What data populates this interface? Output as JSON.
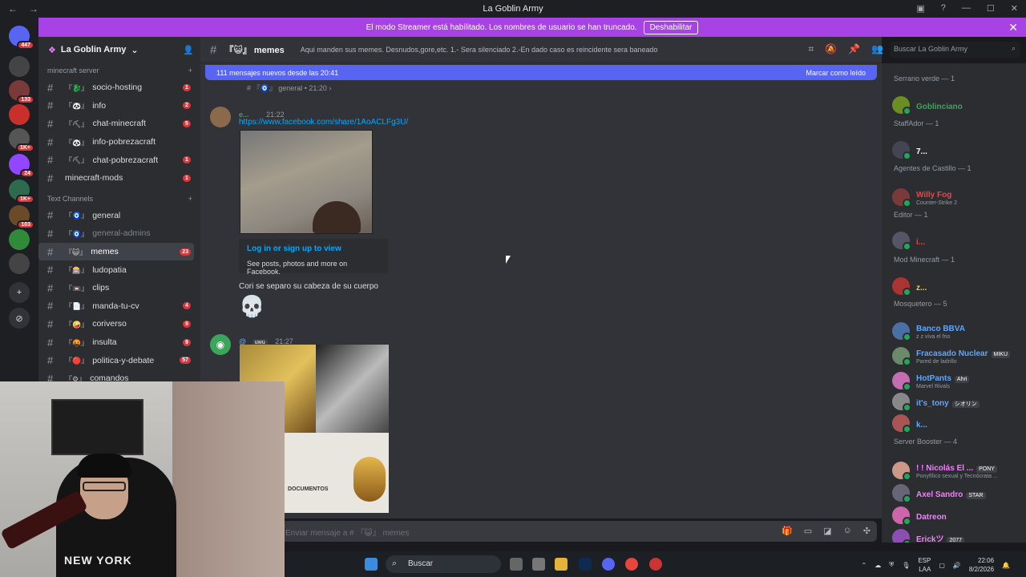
{
  "window": {
    "title": "La Goblin Army"
  },
  "streamer_banner": {
    "text": "El modo Streamer está habilitado. Los nombres de usuario se han truncado.",
    "button": "Deshabilitar"
  },
  "servers": [
    {
      "badge": "447",
      "color": "#5865f2"
    },
    {
      "badge": "",
      "color": "#444"
    },
    {
      "badge": "133",
      "color": "#7a3a3a"
    },
    {
      "badge": "",
      "color": "#c9302c"
    },
    {
      "badge": "1K+",
      "color": "#555"
    },
    {
      "badge": "24",
      "color": "#9146ff"
    },
    {
      "badge": "1K+",
      "color": "#2d6a4f"
    },
    {
      "badge": "103",
      "color": "#6b4a2a"
    },
    {
      "badge": "",
      "color": "#2f8a3a"
    },
    {
      "badge": "",
      "color": "#444"
    }
  ],
  "sidebar": {
    "server_name": "La Goblin Army",
    "cat1": "minecraft server",
    "channels1": [
      {
        "emoji": "『🐉』",
        "name": "socio-hosting",
        "badge": "1"
      },
      {
        "emoji": "『🐼』",
        "name": "info",
        "badge": "2"
      },
      {
        "emoji": "『⛏』",
        "name": "chat-minecraft",
        "badge": "5"
      },
      {
        "emoji": "『🐼』",
        "name": "info-pobrezacraft",
        "badge": ""
      },
      {
        "emoji": "『⛏』",
        "name": "chat-pobrezacraft",
        "badge": "1"
      },
      {
        "emoji": "",
        "name": "minecraft-mods",
        "badge": "1"
      }
    ],
    "cat2": "Text Channels",
    "channels2": [
      {
        "emoji": "『🧿』",
        "name": "general",
        "badge": ""
      },
      {
        "emoji": "『🧿』",
        "name": "general-admins",
        "badge": ""
      },
      {
        "emoji": "『😺』",
        "name": "memes",
        "badge": "23"
      },
      {
        "emoji": "『🎰』",
        "name": "ludopatia",
        "badge": ""
      },
      {
        "emoji": "『📼』",
        "name": "clips",
        "badge": ""
      },
      {
        "emoji": "『📄』",
        "name": "manda-tu-cv",
        "badge": "4"
      },
      {
        "emoji": "『🤪』",
        "name": "coriverso",
        "badge": "9"
      },
      {
        "emoji": "『🤬』",
        "name": "insulta",
        "badge": "9"
      },
      {
        "emoji": "『🔴』",
        "name": "politica-y-debate",
        "badge": "57"
      },
      {
        "emoji": "『⚙』",
        "name": "comandos",
        "badge": ""
      }
    ]
  },
  "header": {
    "channel": "『😺』 memes",
    "topic": "Aqui manden sus memes. Desnudos,gore,etc. 1.- Sera silenciado 2.-En dado caso es reincidente sera baneado",
    "search_placeholder": "Buscar La Goblin Army"
  },
  "chat": {
    "new_messages": "111 mensajes nuevos desde las 20:41",
    "mark_read": "Marcar como leído",
    "reply_ref": "# 『🧿』 general • 21:20 ›",
    "msg1": {
      "author": "e...",
      "time": "21:22",
      "link": "https://www.facebook.com/share/1AoACLFg3U/",
      "embed_title": "Log in or sign up to view",
      "embed_desc": "See posts, photos and more on Facebook.",
      "text": "Cori se separo su cabeza de su cuerpo",
      "emoji": "💀"
    },
    "msg2": {
      "author": "@",
      "tag": "uwu",
      "time": "21:27",
      "doc_text": "DOCUMENTOS"
    },
    "input_placeholder": "Enviar mensaje a # 『😺』 memes"
  },
  "members": {
    "groups": [
      {
        "title": "Serrano verde — 1",
        "members": [
          {
            "name": "Goblinciano",
            "color": "#3ba55c",
            "status": "",
            "tag": ""
          }
        ]
      },
      {
        "title": "StaffAdor — 1",
        "members": [
          {
            "name": "7...",
            "color": "#fff",
            "status": "",
            "tag": ""
          }
        ]
      },
      {
        "title": "Agentes de Castillo — 1",
        "members": [
          {
            "name": "Willy Fog",
            "color": "#e04a4a",
            "status": "Counter-Strike 2",
            "tag": ""
          }
        ]
      },
      {
        "title": "Editor — 1",
        "members": [
          {
            "name": "i...",
            "color": "#e04a4a",
            "status": "",
            "tag": ""
          }
        ]
      },
      {
        "title": "Mod Minecraft — 1",
        "members": [
          {
            "name": "z...",
            "color": "#f0d23c",
            "status": "",
            "tag": ""
          }
        ]
      },
      {
        "title": "Mosquetero — 5",
        "members": [
          {
            "name": "Banco BBVA",
            "color": "#5ea7ff",
            "status": "z z viva el frio",
            "tag": ""
          },
          {
            "name": "Fracasado Nuclear",
            "color": "#5ea7ff",
            "status": "Pared de ladrillo",
            "tag": "MIKU"
          },
          {
            "name": "HotPants",
            "color": "#5ea7ff",
            "status": "Marvel Rivals",
            "tag": "Ahri"
          },
          {
            "name": "it's_tony",
            "color": "#5ea7ff",
            "status": "",
            "tag": "シオリン"
          },
          {
            "name": "k...",
            "color": "#5ea7ff",
            "status": "",
            "tag": ""
          }
        ]
      },
      {
        "title": "Server Booster — 4",
        "members": [
          {
            "name": "! ! Nicolás El ...",
            "color": "#f47fff",
            "status": "Ponyfílico sexual y Tecnócrata ...",
            "tag": "PONY"
          },
          {
            "name": "Axel Sandro",
            "color": "#f47fff",
            "status": "",
            "tag": "STAR"
          },
          {
            "name": "Datreon",
            "color": "#f47fff",
            "status": "",
            "tag": ""
          },
          {
            "name": "Erickツ",
            "color": "#f47fff",
            "status": "",
            "tag": "2077"
          }
        ]
      }
    ]
  },
  "taskbar": {
    "search": "Buscar",
    "lang1": "ESP",
    "lang2": "LAA",
    "time": "22:06",
    "date": "8/2/2026"
  },
  "webcam": {
    "shirt_text": "NEW YORK"
  }
}
